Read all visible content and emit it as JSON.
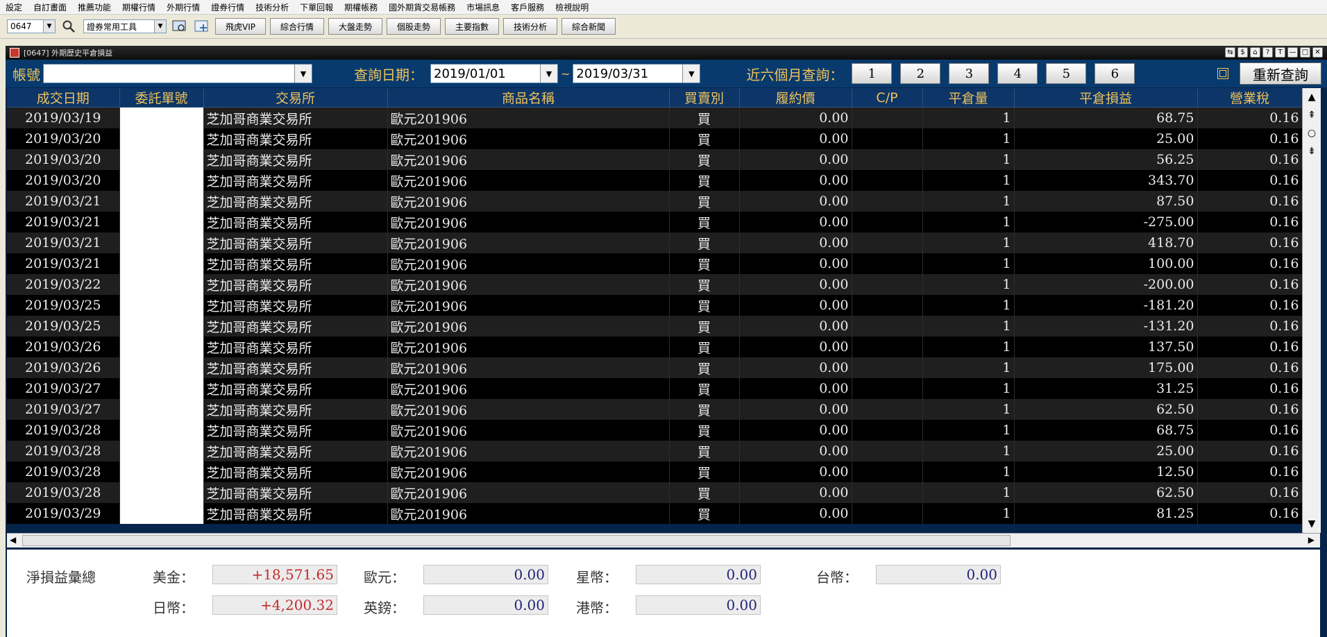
{
  "menu": [
    "設定",
    "自訂畫面",
    "推薦功能",
    "期權行情",
    "外期行情",
    "證券行情",
    "技術分析",
    "下單回報",
    "期權帳務",
    "國外期貨交易帳務",
    "市場訊息",
    "客戶服務",
    "檢視說明"
  ],
  "toolbar": {
    "code_value": "0647",
    "tool_select": "證券常用工具",
    "buttons": [
      "飛虎VIP",
      "綜合行情",
      "大盤走勢",
      "個股走勢",
      "主要指數",
      "技術分析",
      "綜合新聞"
    ]
  },
  "window": {
    "title": "[0647] 外期歷史平倉損益",
    "controls": [
      "⇆",
      "$",
      "⌂",
      "?",
      "T",
      "—",
      "□",
      "✕"
    ]
  },
  "query": {
    "account_label": "帳號",
    "account_value": "",
    "date_label": "查詢日期：",
    "date_from": "2019/01/01",
    "tilde": "~",
    "date_to": "2019/03/31",
    "recent_label": "近六個月查詢：",
    "months": [
      "1",
      "2",
      "3",
      "4",
      "5",
      "6"
    ],
    "refresh_label": "重新查詢"
  },
  "table": {
    "headers": [
      "成交日期",
      "委託單號",
      "交易所",
      "商品名稱",
      "買賣別",
      "履約價",
      "C/P",
      "平倉量",
      "平倉損益",
      "營業稅"
    ],
    "rows": [
      [
        "2019/03/19",
        "",
        "芝加哥商業交易所",
        "歐元201906",
        "買",
        "0.00",
        "",
        "1",
        "68.75",
        "0.16"
      ],
      [
        "2019/03/20",
        "",
        "芝加哥商業交易所",
        "歐元201906",
        "買",
        "0.00",
        "",
        "1",
        "25.00",
        "0.16"
      ],
      [
        "2019/03/20",
        "",
        "芝加哥商業交易所",
        "歐元201906",
        "買",
        "0.00",
        "",
        "1",
        "56.25",
        "0.16"
      ],
      [
        "2019/03/20",
        "",
        "芝加哥商業交易所",
        "歐元201906",
        "買",
        "0.00",
        "",
        "1",
        "343.70",
        "0.16"
      ],
      [
        "2019/03/21",
        "",
        "芝加哥商業交易所",
        "歐元201906",
        "買",
        "0.00",
        "",
        "1",
        "87.50",
        "0.16"
      ],
      [
        "2019/03/21",
        "",
        "芝加哥商業交易所",
        "歐元201906",
        "買",
        "0.00",
        "",
        "1",
        "-275.00",
        "0.16"
      ],
      [
        "2019/03/21",
        "",
        "芝加哥商業交易所",
        "歐元201906",
        "買",
        "0.00",
        "",
        "1",
        "418.70",
        "0.16"
      ],
      [
        "2019/03/21",
        "",
        "芝加哥商業交易所",
        "歐元201906",
        "買",
        "0.00",
        "",
        "1",
        "100.00",
        "0.16"
      ],
      [
        "2019/03/22",
        "",
        "芝加哥商業交易所",
        "歐元201906",
        "買",
        "0.00",
        "",
        "1",
        "-200.00",
        "0.16"
      ],
      [
        "2019/03/25",
        "",
        "芝加哥商業交易所",
        "歐元201906",
        "買",
        "0.00",
        "",
        "1",
        "-181.20",
        "0.16"
      ],
      [
        "2019/03/25",
        "",
        "芝加哥商業交易所",
        "歐元201906",
        "買",
        "0.00",
        "",
        "1",
        "-131.20",
        "0.16"
      ],
      [
        "2019/03/26",
        "",
        "芝加哥商業交易所",
        "歐元201906",
        "買",
        "0.00",
        "",
        "1",
        "137.50",
        "0.16"
      ],
      [
        "2019/03/26",
        "",
        "芝加哥商業交易所",
        "歐元201906",
        "買",
        "0.00",
        "",
        "1",
        "175.00",
        "0.16"
      ],
      [
        "2019/03/27",
        "",
        "芝加哥商業交易所",
        "歐元201906",
        "買",
        "0.00",
        "",
        "1",
        "31.25",
        "0.16"
      ],
      [
        "2019/03/27",
        "",
        "芝加哥商業交易所",
        "歐元201906",
        "買",
        "0.00",
        "",
        "1",
        "62.50",
        "0.16"
      ],
      [
        "2019/03/28",
        "",
        "芝加哥商業交易所",
        "歐元201906",
        "買",
        "0.00",
        "",
        "1",
        "68.75",
        "0.16"
      ],
      [
        "2019/03/28",
        "",
        "芝加哥商業交易所",
        "歐元201906",
        "買",
        "0.00",
        "",
        "1",
        "25.00",
        "0.16"
      ],
      [
        "2019/03/28",
        "",
        "芝加哥商業交易所",
        "歐元201906",
        "買",
        "0.00",
        "",
        "1",
        "12.50",
        "0.16"
      ],
      [
        "2019/03/28",
        "",
        "芝加哥商業交易所",
        "歐元201906",
        "買",
        "0.00",
        "",
        "1",
        "62.50",
        "0.16"
      ],
      [
        "2019/03/29",
        "",
        "芝加哥商業交易所",
        "歐元201906",
        "買",
        "0.00",
        "",
        "1",
        "81.25",
        "0.16"
      ]
    ]
  },
  "summary": {
    "title": "淨損益彙總",
    "usd_label": "美金：",
    "usd_value": "+18,571.65",
    "jpy_label": "日幣：",
    "jpy_value": "+4,200.32",
    "eur_label": "歐元：",
    "eur_value": "0.00",
    "gbp_label": "英鎊：",
    "gbp_value": "0.00",
    "sgd_label": "星幣：",
    "sgd_value": "0.00",
    "hkd_label": "港幣：",
    "hkd_value": "0.00",
    "twd_label": "台幣：",
    "twd_value": "0.00"
  },
  "colors": {
    "header_gold": "#f0c35a",
    "query_bar": "#083a6e",
    "profit_red": "#c42a2a",
    "value_navy": "#23237a"
  }
}
